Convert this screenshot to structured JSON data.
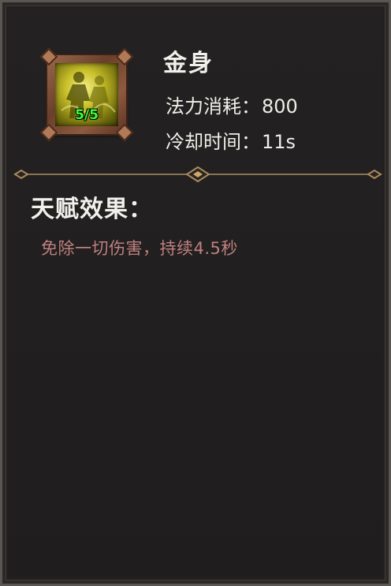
{
  "skill": {
    "name": "金身",
    "level": "5/5",
    "icon": "golden-body-skill-icon",
    "mana_label": "法力消耗：",
    "mana_value": "800",
    "cooldown_label": "冷却时间：",
    "cooldown_value": "11s"
  },
  "talent": {
    "title": "天赋效果：",
    "effect": "免除一切伤害，持续4.5秒"
  },
  "colors": {
    "level_text": "#3cff3c",
    "effect_text": "#c08080",
    "divider_gold": "#a88a5e"
  }
}
